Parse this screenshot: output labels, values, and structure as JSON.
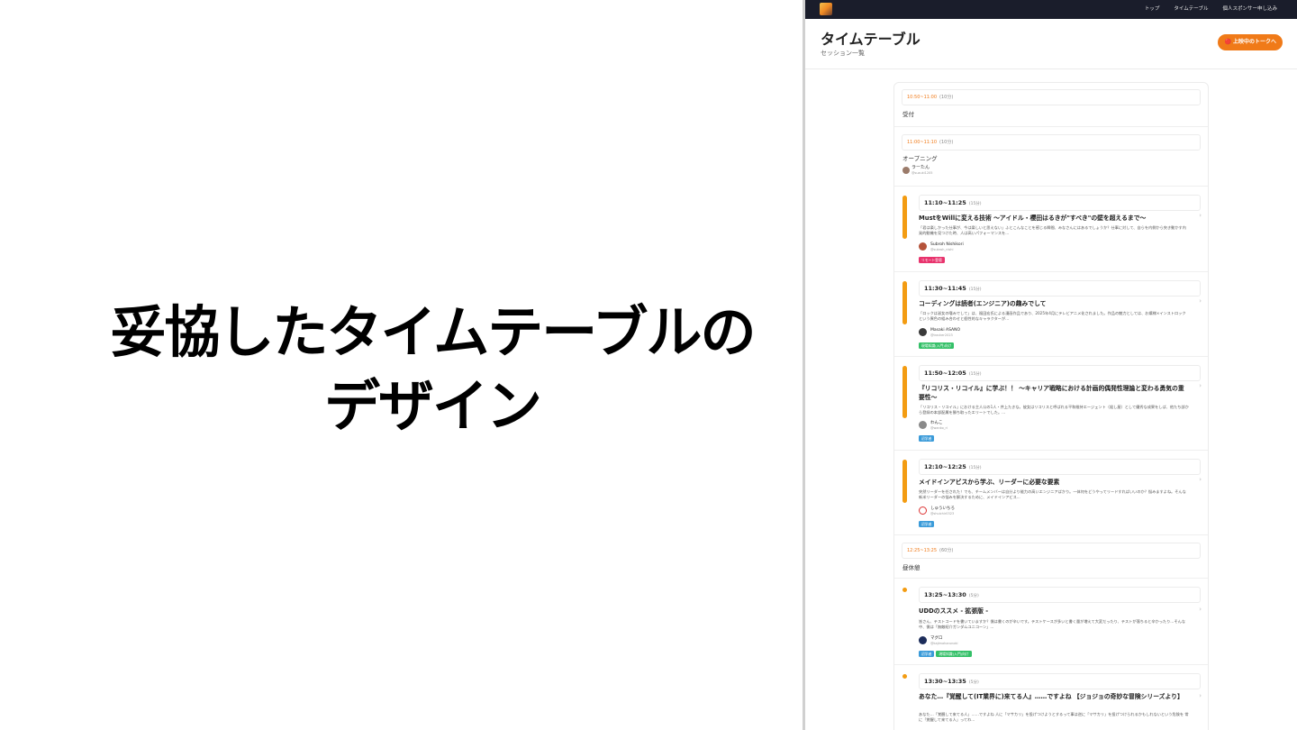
{
  "slide": {
    "title_line1": "妥協したタイムテーブルの",
    "title_line2": "デザイン"
  },
  "nav": {
    "links": [
      "トップ",
      "タイムテーブル",
      "個人スポンサー申し込み"
    ]
  },
  "header": {
    "title": "タイムテーブル",
    "subtitle": "セッション一覧",
    "live_button": "🔴 上映中のトークへ"
  },
  "colors": {
    "accent": "#f07a18",
    "session_bar": "#f39c12",
    "navbar": "#1a1d2b",
    "tag_remote": "#e8336d",
    "tag_level": "#3b9bd9",
    "tag_green": "#34c068"
  },
  "timeline": {
    "reception": {
      "time": "10:50~11:00",
      "duration": "(10分)",
      "title": "受付"
    },
    "opening": {
      "time": "11:00~11:10",
      "duration": "(10分)",
      "title": "オープニング",
      "speaker": "ラーたん",
      "handle": "@suzuki1205"
    },
    "sessions": [
      {
        "time": "11:10~11:25",
        "duration": "(15分)",
        "title": "MustをWillに変える技術 〜アイドル・櫻田はるきが\"すべき\"の壁を超えるまで〜",
        "desc": "「君は楽しかった仕事が、今は楽しいと思えない」ふとこんなことを感じる瞬間、みなさんにはあるでしょうか？仕事に対して、自らを内側から突き動かす内発的動機を見つけた時、人は高いパフォーマンスを...",
        "speaker": "Subroh Nishikori",
        "handle": "@subroh_nishi",
        "tags": [
          {
            "label": "リモート登壇",
            "kind": "tag_remote"
          }
        ]
      },
      {
        "time": "11:30~11:45",
        "duration": "(15分)",
        "title": "コーディングは読者(エンジニア)の趣みでして",
        "desc": "「ロックは淑女の嗜みでして」は、福田宏氏による漫画作品であり、2025年4月にテレビアニメ化されました。作品の魅力としては、お嬢様×インストロックという異色の組み合わせと個性的なキャラクターが...",
        "speaker": "Masaki ASANO",
        "handle": "@tracker2023",
        "tags": [
          {
            "label": "現場知識(入門)向け",
            "kind": "tag_green"
          }
        ]
      },
      {
        "time": "11:50~12:05",
        "duration": "(15分)",
        "title": "『リコリス・リコイル』に学ぶ！！ 〜キャリア戦略における計画的偶発性理論と変わる勇気の重要性〜",
        "desc": "「リコリス・リコイル」における主人公の1人・井上たきな。彼女はリコリスと呼ばれる平和維持エージェント（殺し屋）として優秀な成果をしば、他たち部から登録の本部配属を勝ち取ったエリートでした。...",
        "speaker": "わんこ",
        "handle": "@wanko_ri",
        "tags": [
          {
            "label": "初学者",
            "kind": "tag_level"
          }
        ]
      },
      {
        "time": "12:10~12:25",
        "duration": "(15分)",
        "title": "メイドインアビスから学ぶ、リーダーに必要な要素",
        "desc": "突然リーダーを任された！でも、チームメンバーは自分より能力の高いエンジニアばかり。一体何をどうやってリードすればいいのか？悩みますよね。そんな新米リーダーの悩みを解決するために、メイドインアビス...",
        "speaker": "しゅういちろ",
        "handle": "@shuichir0323",
        "tags": [
          {
            "label": "初学者",
            "kind": "tag_level"
          }
        ]
      }
    ],
    "break": {
      "time": "12:25~13:25",
      "duration": "(60分)",
      "title": "昼休憩"
    },
    "sessions2": [
      {
        "time": "13:25~13:30",
        "duration": "(5分)",
        "title": "UDDのススメ - 拡張版 -",
        "desc": "皆さん、テストコードを書いていますか？僕は書くのが辛いです。テストケースが多いと書く量が増えて大変だったり、テストが落ちると辛かったり…そんな中、僕は「無敵紹介ガンダムユニコーン」...",
        "speaker": "マグロ",
        "handle": "@kajimaharunoki",
        "tags": [
          {
            "label": "初学者",
            "kind": "tag_level"
          },
          {
            "label": "現場知識(入門)向け",
            "kind": "tag_green"
          }
        ]
      },
      {
        "time": "13:30~13:35",
        "duration": "(5分)",
        "title": "あなた…『覚醒して(IT業界に)来てる人』……ですよね 【ジョジョの奇妙な冒険シリーズより】",
        "desc": "あなた…「覚醒して来てる人」……ですよね 人に「マサカリ」を投げつけようとするって事は逆に「マサカリ」を投げつけられるかもしれないという危険を 常に「覚醒して来てる人」ってわ...",
        "speaker": "",
        "handle": "",
        "tags": []
      }
    ]
  }
}
